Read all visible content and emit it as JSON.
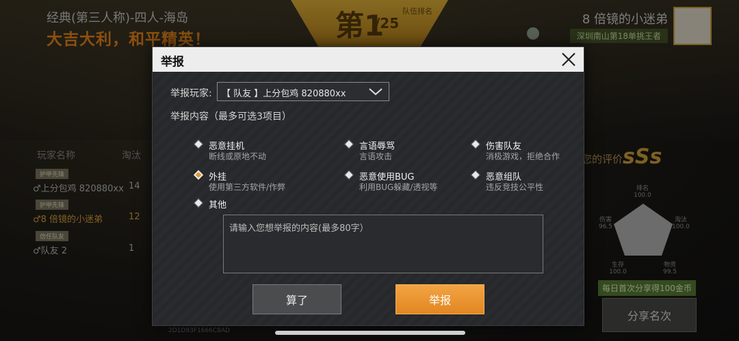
{
  "background": {
    "mode_title": "经典(第三人称)-四人-海岛",
    "slogan": "大吉大利，和平精英！",
    "rank": {
      "prefix": "第",
      "number": "1",
      "total": "/25",
      "label": "队伍排名"
    },
    "player": {
      "name": "8 倍镜的小迷弟",
      "title": "深圳南山第18单挑王者"
    },
    "table_headers": {
      "name": "玩家名称",
      "kills": "淘汰"
    },
    "players": [
      {
        "tag": "护甲先锋",
        "name": "♂上分包鸡 820880xx",
        "kills": "14",
        "me": false
      },
      {
        "tag": "护甲先锋",
        "name": "♂8 倍镜的小迷弟",
        "kills": "12",
        "me": true
      },
      {
        "tag": "信任队友",
        "name": "♂队友 2",
        "kills": "1",
        "me": false
      }
    ],
    "evaluation": {
      "label": "您的评价",
      "grade": "sSs"
    },
    "stats": {
      "rank": "排名",
      "rank_v": "100.0",
      "damage": "伤害",
      "damage_v": "96.5",
      "kills": "淘汰",
      "kills_v": "100.0",
      "survival": "生存",
      "survival_v": "100.0",
      "items": "物资",
      "items_v": "99.5"
    },
    "share_tip": "每日首次分享得100金币",
    "share_button": "分享名次",
    "bottom_id": "2D1D93F1666C8AD"
  },
  "dialog": {
    "title": "举报",
    "player_label": "举报玩家:",
    "player_value": "【 队友 】上分包鸡 820880xx",
    "content_label": "举报内容（最多可选3项目）",
    "options": [
      {
        "title": "恶意挂机",
        "desc": "断线或原地不动",
        "selected": false
      },
      {
        "title": "言语辱骂",
        "desc": "言语攻击",
        "selected": false
      },
      {
        "title": "伤害队友",
        "desc": "消极游戏，拒绝合作",
        "selected": false
      },
      {
        "title": "外挂",
        "desc": "使用第三方软件/作弊",
        "selected": true
      },
      {
        "title": "恶意使用BUG",
        "desc": "利用BUG躲藏/透视等",
        "selected": false
      },
      {
        "title": "恶意组队",
        "desc": "违反竞技公平性",
        "selected": false
      },
      {
        "title": "其他",
        "desc": "",
        "selected": false
      }
    ],
    "textarea_placeholder": "请输入您想举报的内容(最多80字）",
    "cancel_label": "算了",
    "submit_label": "举报"
  },
  "colors": {
    "accent": "#e18722",
    "selected_option": "#e0952b",
    "slogan": "#f08a1a"
  }
}
